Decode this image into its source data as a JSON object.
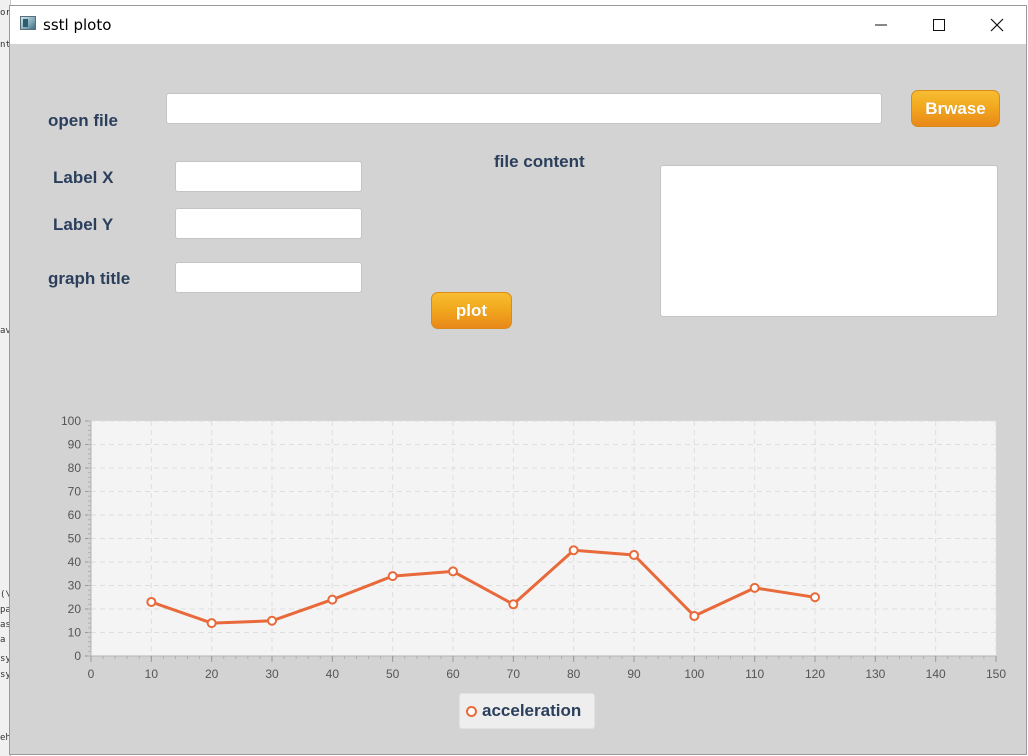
{
  "window": {
    "title": "sstl ploto",
    "controls": {
      "minimize_icon": "minimize-icon",
      "maximize_icon": "maximize-icon",
      "close_icon": "close-icon"
    }
  },
  "form": {
    "open_file_label": "open file",
    "open_file_value": "",
    "browse_button": "Brwase",
    "label_x_label": "Label X",
    "label_x_value": "",
    "label_y_label": "Label Y",
    "label_y_value": "",
    "graph_title_label": "graph title",
    "graph_title_value": "",
    "file_content_label": "file content",
    "file_content_value": "",
    "plot_button": "plot"
  },
  "colors": {
    "background": "#d3d3d3",
    "label_text": "#2b3f5c",
    "button_orange": "#f2a91e",
    "series_line": "#e8693a",
    "plot_background": "#f4f4f4"
  },
  "chart_data": {
    "type": "line",
    "title": "",
    "xlabel": "",
    "ylabel": "",
    "xlim": [
      0,
      150
    ],
    "ylim": [
      0,
      100
    ],
    "x_ticks": [
      0,
      10,
      20,
      30,
      40,
      50,
      60,
      70,
      80,
      90,
      100,
      110,
      120,
      130,
      140,
      150
    ],
    "y_ticks": [
      0,
      10,
      20,
      30,
      40,
      50,
      60,
      70,
      80,
      90,
      100
    ],
    "grid": true,
    "legend_position": "bottom-center",
    "series": [
      {
        "name": "acceleration",
        "x": [
          10,
          20,
          30,
          40,
          50,
          60,
          70,
          80,
          90,
          100,
          110,
          120
        ],
        "y": [
          23,
          14,
          15,
          24,
          34,
          36,
          22,
          45,
          43,
          17,
          29,
          25
        ]
      }
    ]
  }
}
